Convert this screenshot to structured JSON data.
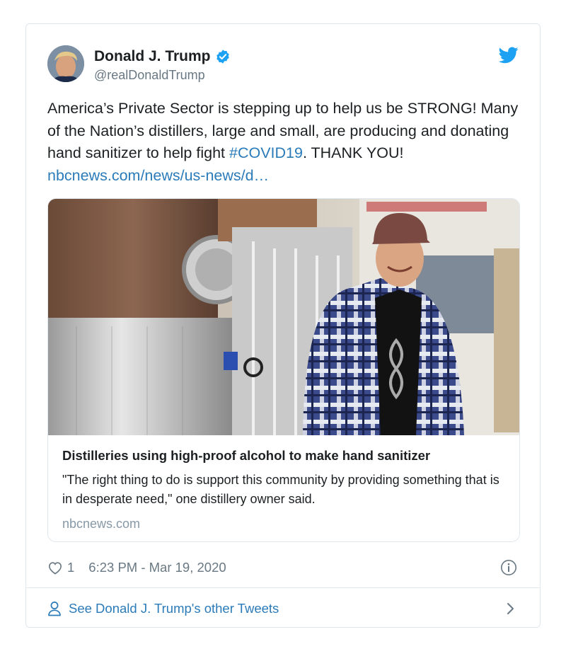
{
  "tweet": {
    "author_name": "Donald J. Trump",
    "author_handle": "@realDonaldTrump",
    "text_before": "America’s Private Sector is stepping up to help us be STRONG! Many of the Nation’s distillers, large and small, are producing and donating hand sanitizer to help fight ",
    "hashtag": "#COVID19",
    "text_after": ". THANK YOU! ",
    "link_text": "nbcnews.com/news/us-news/d…",
    "verified": true
  },
  "link_card": {
    "title": "Distilleries using high-proof alcohol to make hand sanitizer",
    "description": "\"The right thing to do is support this community by providing something that is in desperate need,\" one distillery owner said.",
    "domain": "nbcnews.com"
  },
  "meta": {
    "like_count": "1",
    "timestamp": "6:23 PM - Mar 19, 2020"
  },
  "footer": {
    "other_tweets_label": "See Donald J. Trump's other Tweets"
  },
  "colors": {
    "twitter_blue": "#1da1f2",
    "link_blue": "#2b7bb9",
    "muted_gray": "#697882",
    "border": "#e1e8ed"
  },
  "icons": [
    "verified-badge-icon",
    "twitter-bird-icon",
    "heart-icon",
    "info-icon",
    "person-icon",
    "chevron-right-icon"
  ]
}
